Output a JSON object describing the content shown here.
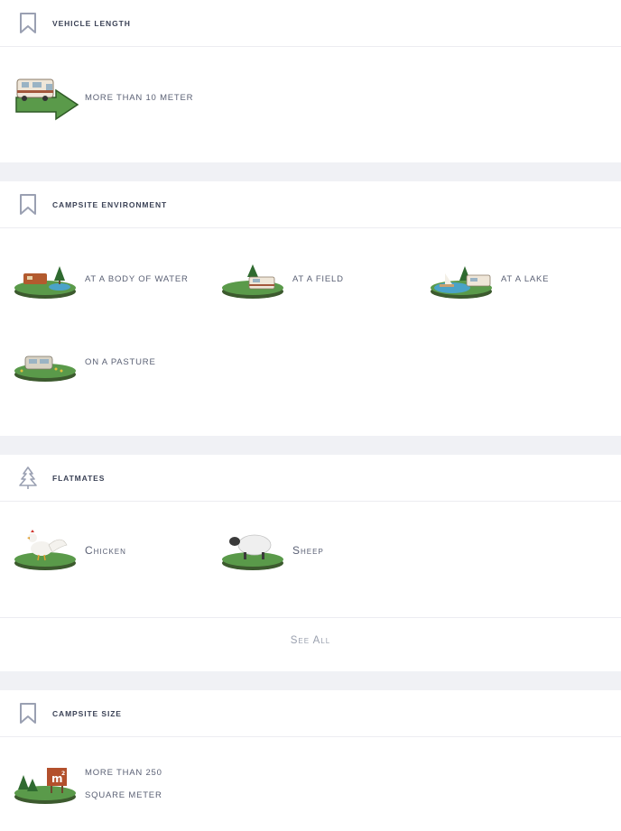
{
  "vehicle_length": {
    "title": "Vehicle length",
    "items": [
      {
        "label": "More than 10 meter",
        "icon": "camper-arrow-icon"
      }
    ]
  },
  "campsite_environment": {
    "title": "Campsite environment",
    "items": [
      {
        "label": "At a body of water",
        "icon": "body-of-water-icon"
      },
      {
        "label": "At a field",
        "icon": "field-icon"
      },
      {
        "label": "At a lake",
        "icon": "lake-icon"
      },
      {
        "label": "On a pasture",
        "icon": "pasture-icon"
      }
    ]
  },
  "flatmates": {
    "title": "Flatmates",
    "items": [
      {
        "label": "Chicken",
        "icon": "chicken-icon"
      },
      {
        "label": "Sheep",
        "icon": "sheep-icon"
      }
    ],
    "see_all": "See All"
  },
  "campsite_size": {
    "title": "Campsite size",
    "items": [
      {
        "label_line1": "More than 250",
        "label_line2": "square meter",
        "icon": "square-meter-icon"
      }
    ]
  },
  "colors": {
    "grass": "#5a9a4a",
    "soil": "#3c5a2e",
    "separator": "#f0f1f5",
    "header_text": "#3b4256",
    "muted": "#9aa0ae"
  }
}
